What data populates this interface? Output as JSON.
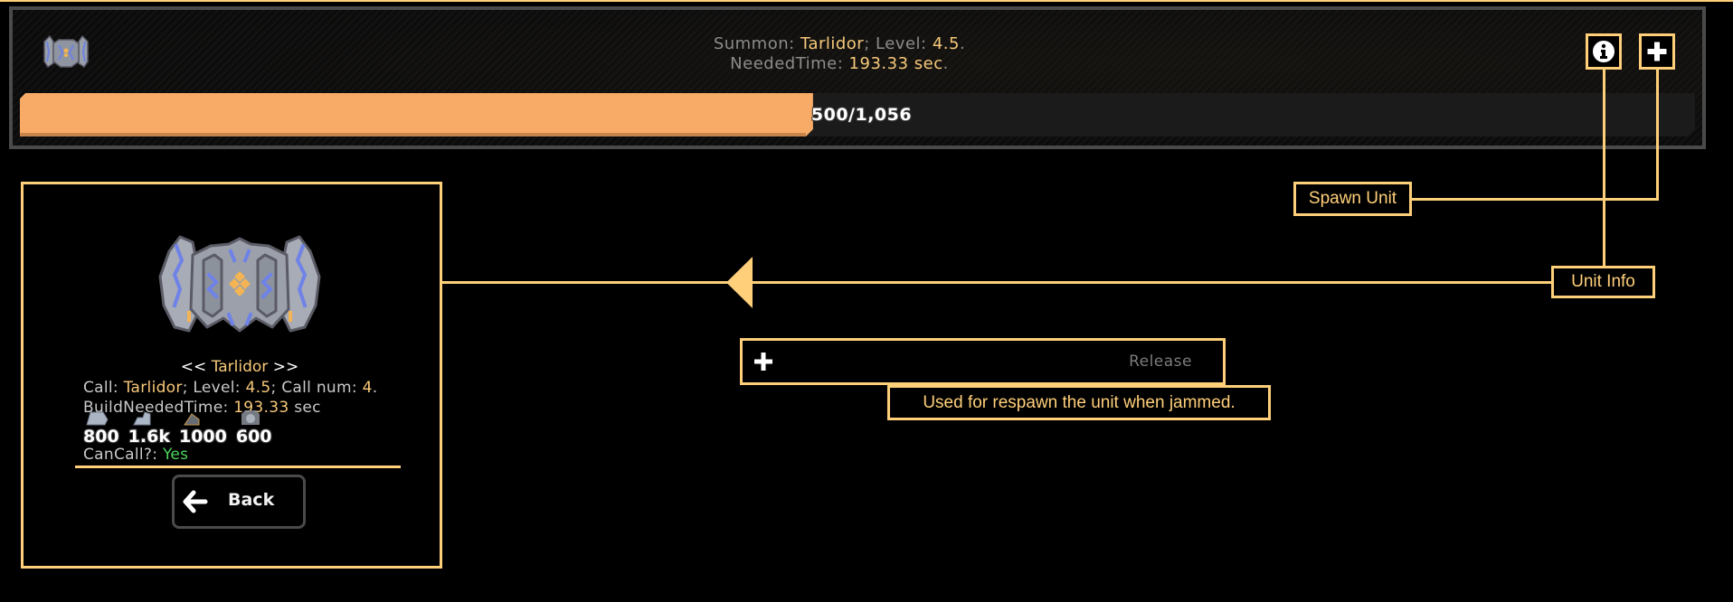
{
  "summon_panel": {
    "summary_line1": {
      "prefix": "Summon: ",
      "unit": "Tarlidor",
      "mid": "; Level: ",
      "level": "4.5",
      "suffix": "."
    },
    "summary_line2": {
      "prefix": "NeededTime: ",
      "time": "193.33 sec",
      "suffix": "."
    },
    "progress": {
      "current": 500,
      "max": 1056,
      "label": "500/1,056",
      "fraction": 0.4735
    },
    "buttons": {
      "info_icon": "info-circle-icon",
      "spawn_icon": "plus-icon"
    }
  },
  "callouts": {
    "spawn_unit": "Spawn Unit",
    "unit_info": "Unit Info",
    "release_tooltip": "Used for respawn the unit when jammed."
  },
  "release_row": {
    "icon": "plus-icon",
    "label": "Release"
  },
  "unit_info_panel": {
    "name_left": "<<",
    "name": "Tarlidor",
    "name_right": ">>",
    "call_line": {
      "call_label": "Call: ",
      "call_value": "Tarlidor",
      "level_label": "; Level: ",
      "level_value": "4.5",
      "callnum_label": "; Call num: ",
      "callnum_value": "4",
      "end": "."
    },
    "build_line": {
      "label": "BuildNeededTime: ",
      "value": "193.33",
      "unit": " sec"
    },
    "resources": [
      {
        "icon": "metal-icon",
        "amount": "800"
      },
      {
        "icon": "crystal-icon",
        "amount": "1.6k"
      },
      {
        "icon": "alloy-icon",
        "amount": "1000"
      },
      {
        "icon": "core-icon",
        "amount": "600"
      }
    ],
    "can_call_label": "CanCall?: ",
    "can_call_value": "Yes",
    "back_label": "Back"
  },
  "colors": {
    "accent": "#ffcf7a",
    "progress_fill": "#f8ab66",
    "highlight_text": "#f7c97a",
    "yes_green": "#4fd35e"
  }
}
